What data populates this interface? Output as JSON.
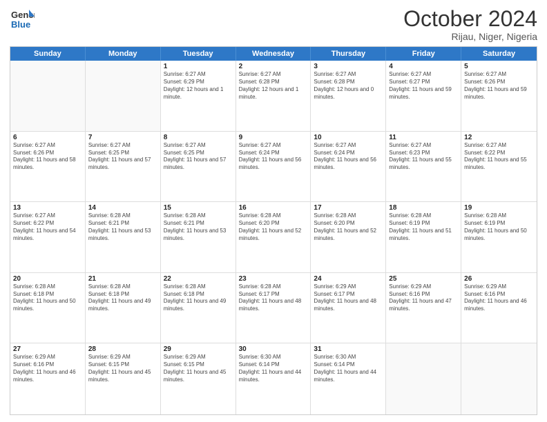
{
  "header": {
    "logo_line1": "General",
    "logo_line2": "Blue",
    "month": "October 2024",
    "location": "Rijau, Niger, Nigeria"
  },
  "weekdays": [
    "Sunday",
    "Monday",
    "Tuesday",
    "Wednesday",
    "Thursday",
    "Friday",
    "Saturday"
  ],
  "rows": [
    [
      {
        "day": "",
        "sunrise": "",
        "sunset": "",
        "daylight": "",
        "empty": true
      },
      {
        "day": "",
        "sunrise": "",
        "sunset": "",
        "daylight": "",
        "empty": true
      },
      {
        "day": "1",
        "sunrise": "Sunrise: 6:27 AM",
        "sunset": "Sunset: 6:29 PM",
        "daylight": "Daylight: 12 hours and 1 minute."
      },
      {
        "day": "2",
        "sunrise": "Sunrise: 6:27 AM",
        "sunset": "Sunset: 6:28 PM",
        "daylight": "Daylight: 12 hours and 1 minute."
      },
      {
        "day": "3",
        "sunrise": "Sunrise: 6:27 AM",
        "sunset": "Sunset: 6:28 PM",
        "daylight": "Daylight: 12 hours and 0 minutes."
      },
      {
        "day": "4",
        "sunrise": "Sunrise: 6:27 AM",
        "sunset": "Sunset: 6:27 PM",
        "daylight": "Daylight: 11 hours and 59 minutes."
      },
      {
        "day": "5",
        "sunrise": "Sunrise: 6:27 AM",
        "sunset": "Sunset: 6:26 PM",
        "daylight": "Daylight: 11 hours and 59 minutes."
      }
    ],
    [
      {
        "day": "6",
        "sunrise": "Sunrise: 6:27 AM",
        "sunset": "Sunset: 6:26 PM",
        "daylight": "Daylight: 11 hours and 58 minutes."
      },
      {
        "day": "7",
        "sunrise": "Sunrise: 6:27 AM",
        "sunset": "Sunset: 6:25 PM",
        "daylight": "Daylight: 11 hours and 57 minutes."
      },
      {
        "day": "8",
        "sunrise": "Sunrise: 6:27 AM",
        "sunset": "Sunset: 6:25 PM",
        "daylight": "Daylight: 11 hours and 57 minutes."
      },
      {
        "day": "9",
        "sunrise": "Sunrise: 6:27 AM",
        "sunset": "Sunset: 6:24 PM",
        "daylight": "Daylight: 11 hours and 56 minutes."
      },
      {
        "day": "10",
        "sunrise": "Sunrise: 6:27 AM",
        "sunset": "Sunset: 6:24 PM",
        "daylight": "Daylight: 11 hours and 56 minutes."
      },
      {
        "day": "11",
        "sunrise": "Sunrise: 6:27 AM",
        "sunset": "Sunset: 6:23 PM",
        "daylight": "Daylight: 11 hours and 55 minutes."
      },
      {
        "day": "12",
        "sunrise": "Sunrise: 6:27 AM",
        "sunset": "Sunset: 6:22 PM",
        "daylight": "Daylight: 11 hours and 55 minutes."
      }
    ],
    [
      {
        "day": "13",
        "sunrise": "Sunrise: 6:27 AM",
        "sunset": "Sunset: 6:22 PM",
        "daylight": "Daylight: 11 hours and 54 minutes."
      },
      {
        "day": "14",
        "sunrise": "Sunrise: 6:28 AM",
        "sunset": "Sunset: 6:21 PM",
        "daylight": "Daylight: 11 hours and 53 minutes."
      },
      {
        "day": "15",
        "sunrise": "Sunrise: 6:28 AM",
        "sunset": "Sunset: 6:21 PM",
        "daylight": "Daylight: 11 hours and 53 minutes."
      },
      {
        "day": "16",
        "sunrise": "Sunrise: 6:28 AM",
        "sunset": "Sunset: 6:20 PM",
        "daylight": "Daylight: 11 hours and 52 minutes."
      },
      {
        "day": "17",
        "sunrise": "Sunrise: 6:28 AM",
        "sunset": "Sunset: 6:20 PM",
        "daylight": "Daylight: 11 hours and 52 minutes."
      },
      {
        "day": "18",
        "sunrise": "Sunrise: 6:28 AM",
        "sunset": "Sunset: 6:19 PM",
        "daylight": "Daylight: 11 hours and 51 minutes."
      },
      {
        "day": "19",
        "sunrise": "Sunrise: 6:28 AM",
        "sunset": "Sunset: 6:19 PM",
        "daylight": "Daylight: 11 hours and 50 minutes."
      }
    ],
    [
      {
        "day": "20",
        "sunrise": "Sunrise: 6:28 AM",
        "sunset": "Sunset: 6:18 PM",
        "daylight": "Daylight: 11 hours and 50 minutes."
      },
      {
        "day": "21",
        "sunrise": "Sunrise: 6:28 AM",
        "sunset": "Sunset: 6:18 PM",
        "daylight": "Daylight: 11 hours and 49 minutes."
      },
      {
        "day": "22",
        "sunrise": "Sunrise: 6:28 AM",
        "sunset": "Sunset: 6:18 PM",
        "daylight": "Daylight: 11 hours and 49 minutes."
      },
      {
        "day": "23",
        "sunrise": "Sunrise: 6:28 AM",
        "sunset": "Sunset: 6:17 PM",
        "daylight": "Daylight: 11 hours and 48 minutes."
      },
      {
        "day": "24",
        "sunrise": "Sunrise: 6:29 AM",
        "sunset": "Sunset: 6:17 PM",
        "daylight": "Daylight: 11 hours and 48 minutes."
      },
      {
        "day": "25",
        "sunrise": "Sunrise: 6:29 AM",
        "sunset": "Sunset: 6:16 PM",
        "daylight": "Daylight: 11 hours and 47 minutes."
      },
      {
        "day": "26",
        "sunrise": "Sunrise: 6:29 AM",
        "sunset": "Sunset: 6:16 PM",
        "daylight": "Daylight: 11 hours and 46 minutes."
      }
    ],
    [
      {
        "day": "27",
        "sunrise": "Sunrise: 6:29 AM",
        "sunset": "Sunset: 6:16 PM",
        "daylight": "Daylight: 11 hours and 46 minutes."
      },
      {
        "day": "28",
        "sunrise": "Sunrise: 6:29 AM",
        "sunset": "Sunset: 6:15 PM",
        "daylight": "Daylight: 11 hours and 45 minutes."
      },
      {
        "day": "29",
        "sunrise": "Sunrise: 6:29 AM",
        "sunset": "Sunset: 6:15 PM",
        "daylight": "Daylight: 11 hours and 45 minutes."
      },
      {
        "day": "30",
        "sunrise": "Sunrise: 6:30 AM",
        "sunset": "Sunset: 6:14 PM",
        "daylight": "Daylight: 11 hours and 44 minutes."
      },
      {
        "day": "31",
        "sunrise": "Sunrise: 6:30 AM",
        "sunset": "Sunset: 6:14 PM",
        "daylight": "Daylight: 11 hours and 44 minutes."
      },
      {
        "day": "",
        "sunrise": "",
        "sunset": "",
        "daylight": "",
        "empty": true
      },
      {
        "day": "",
        "sunrise": "",
        "sunset": "",
        "daylight": "",
        "empty": true
      }
    ]
  ]
}
